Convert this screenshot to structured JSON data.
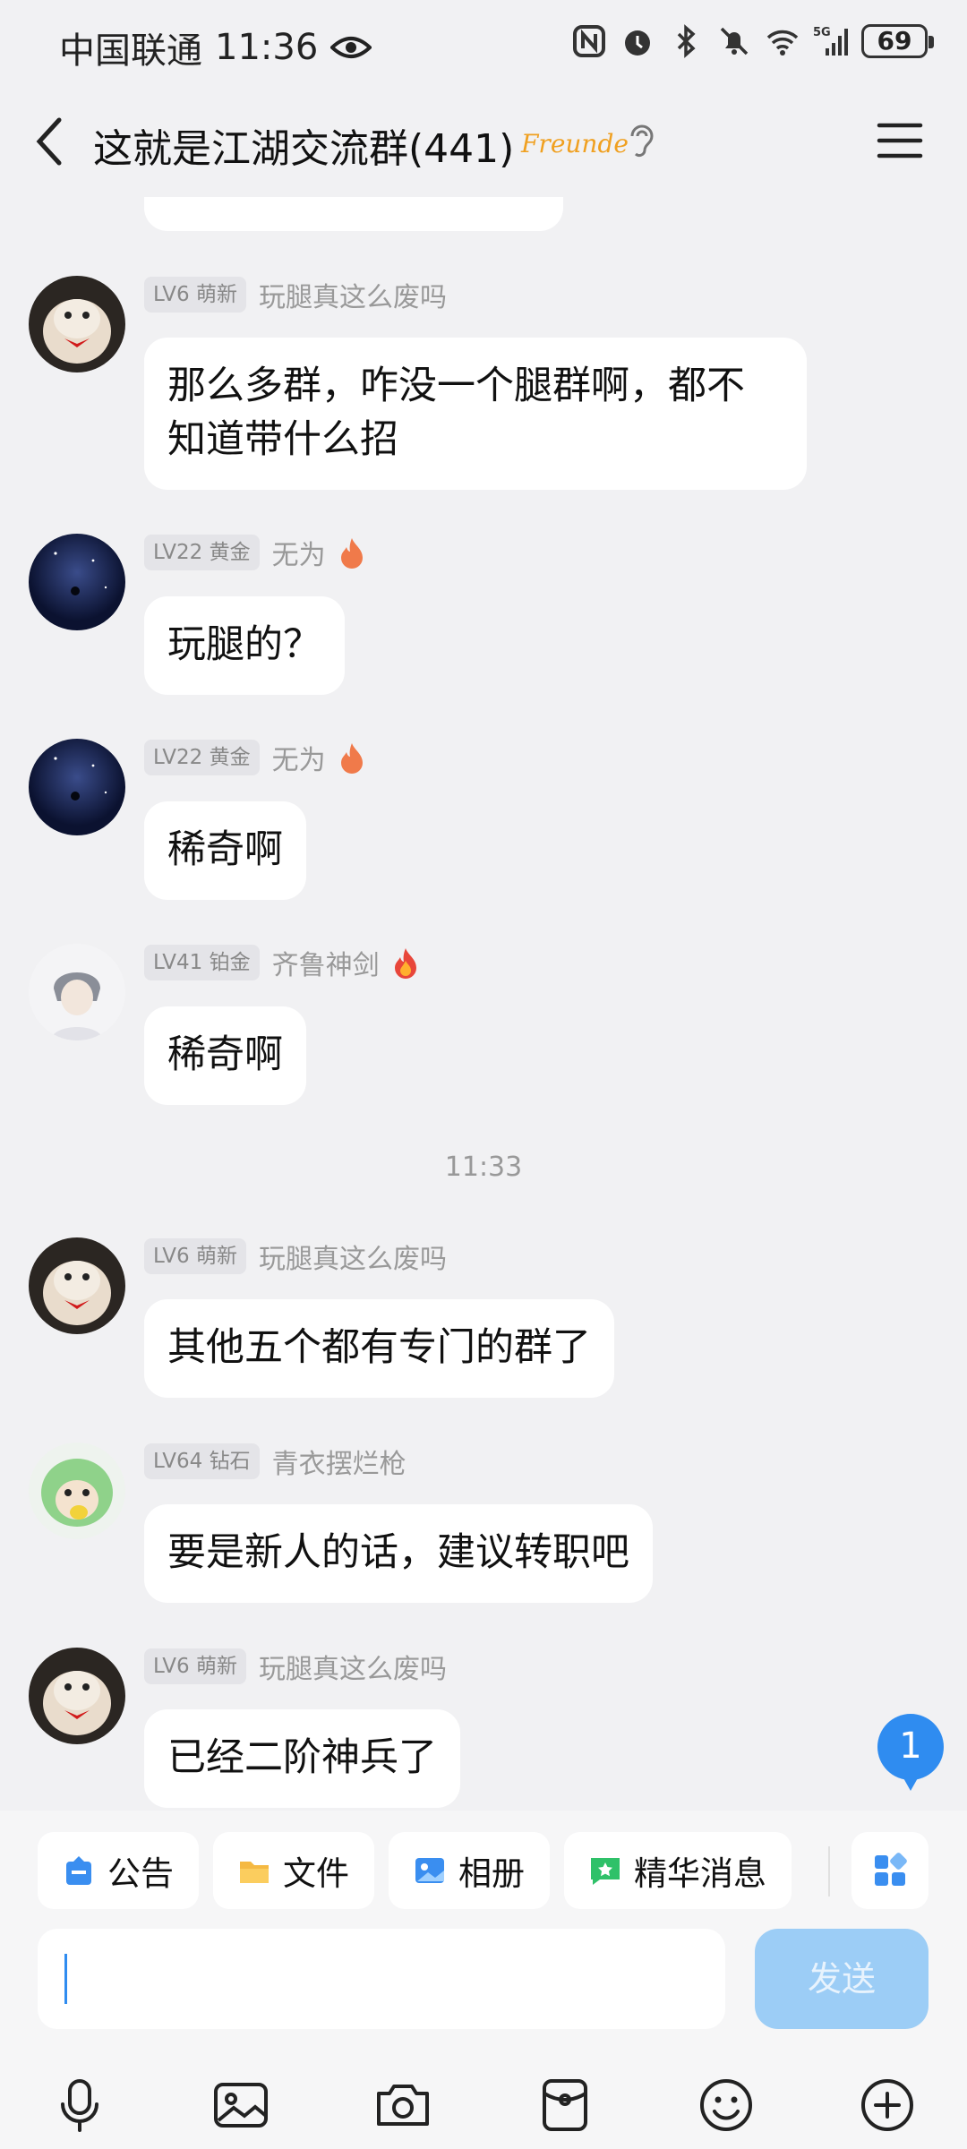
{
  "status_bar": {
    "carrier": "中国联通",
    "time": "11:36",
    "battery": "69"
  },
  "header": {
    "title": "这就是江湖交流群(441)",
    "badge": "Freunde"
  },
  "messages": [
    {
      "level": "LV6 萌新",
      "name": "玩腿真这么废吗",
      "text_line1": "那么多群，咋没一个腿群啊，都不",
      "text_line2": "知道带什么招"
    },
    {
      "level": "LV22 黄金",
      "name": "无为",
      "text": "玩腿的？"
    },
    {
      "level": "LV22 黄金",
      "name": "无为",
      "text": "稀奇啊"
    },
    {
      "level": "LV41 铂金",
      "name": "齐鲁神剑",
      "text": "稀奇啊"
    },
    {
      "level": "LV6 萌新",
      "name": "玩腿真这么废吗",
      "text": "其他五个都有专门的群了"
    },
    {
      "level": "LV64 钻石",
      "name": "青衣摆烂枪",
      "text": "要是新人的话，建议转职吧"
    },
    {
      "level": "LV6 萌新",
      "name": "玩腿真这么废吗",
      "text": "已经二阶神兵了"
    }
  ],
  "timestamp_divider": "11:33",
  "unread_count": "1",
  "quick_actions": [
    "公告",
    "文件",
    "相册",
    "精华消息"
  ],
  "send_label": "发送",
  "colors": {
    "accent": "#2f8cf0",
    "send_disabled": "#9ccdf6",
    "background": "#f1f1f3"
  }
}
